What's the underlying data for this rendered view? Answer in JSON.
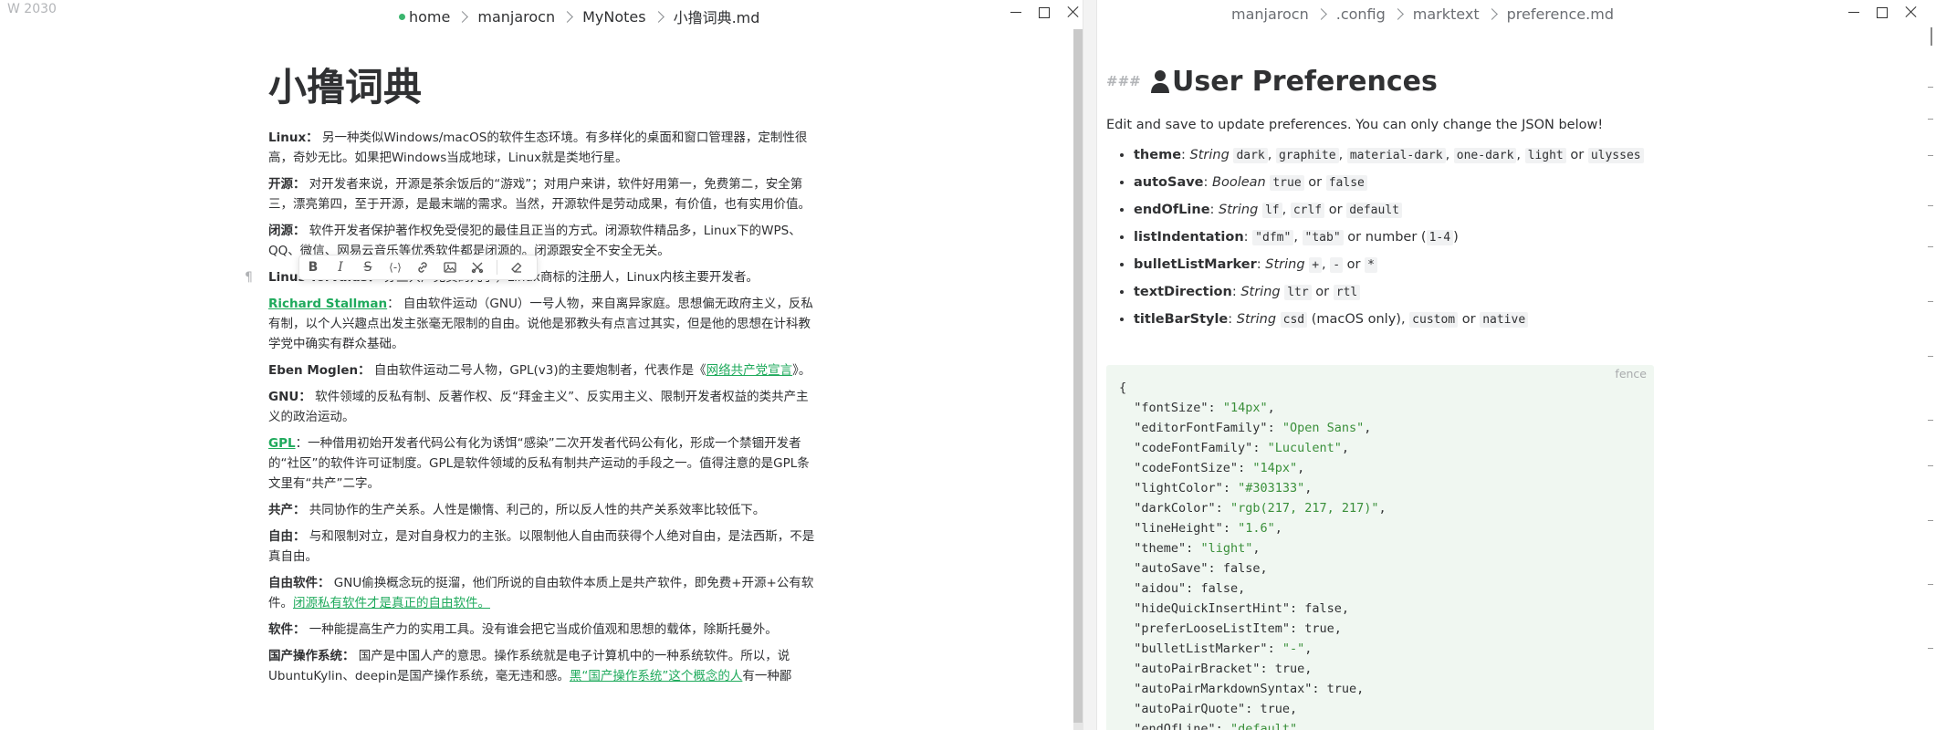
{
  "left": {
    "word_count": "W 2030",
    "breadcrumbs": [
      "home",
      "manjarocn",
      "MyNotes",
      "小撸词典.md"
    ],
    "title": "小撸词典",
    "terms": [
      {
        "name": "Linux：",
        "text": " 另一种类似Windows/macOS的软件生态环境。有多样化的桌面和窗口管理器，定制性很高，奇妙无比。如果把Windows当成地球，Linux就是类地行星。"
      },
      {
        "name": "开源：",
        "text": " 对开发者来说，开源是茶余饭后的“游戏”；对用户来讲，软件好用第一，免费第二，安全第三，漂亮第四，至于开源，是最末端的需求。当然，开源软件是劳动成果，有价值，也有实用价值。"
      },
      {
        "name": "闭源：",
        "text": " 软件开发者保护著作权免受侵犯的最佳且正当的方式。闭源软件精品多，Linux下的WPS、QQ、微信、网易云音乐等优秀软件都是闭源的。闭源跟安全不安全无关。"
      },
      {
        "name": "Linus Torvalds：",
        "text": " 芬兰共产党员的儿子，Linux商标的注册人，Linux内核主要开发者。"
      },
      {
        "name": "Richard Stallman",
        "name_link": true,
        "text": "： 自由软件运动（GNU）一号人物，来自离异家庭。思想偏无政府主义，反私有制，以个人兴趣点出发主张毫无限制的自由。说他是邪教头有点言过其实，但是他的思想在计科教学党中确实有群众基础。"
      },
      {
        "name": "Eben Moglen：",
        "text": " 自由软件运动二号人物，GPL(v3)的主要炮制者，代表作是《",
        "link": "网络共产党宣言",
        "after": "》。"
      },
      {
        "name": "GNU：",
        "text": " 软件领域的反私有制、反著作权、反“拜金主义”、反实用主义、限制开发者权益的类共产主义的政治运动。"
      },
      {
        "name": "GPL",
        "name_link": true,
        "text": "：一种借用初始开发者代码公有化为诱饵“感染”二次开发者代码公有化，形成一个禁锢开发者的“社区”的软件许可证制度。GPL是软件领域的反私有制共产运动的手段之一。值得注意的是GPL条文里有“共产”二字。"
      },
      {
        "name": "共产：",
        "text": " 共同协作的生产关系。人性是懒惰、利己的，所以反人性的共产关系效率比较低下。"
      },
      {
        "name": "自由：",
        "text": " 与和限制对立，是对自身权力的主张。以限制他人自由而获得个人绝对自由，是法西斯，不是真自由。"
      },
      {
        "name": "自由软件：",
        "text": " GNU偷换概念玩的挺溜，他们所说的自由软件本质上是共产软件，即免费+开源+公有软件。",
        "link": "闭源私有软件才是真正的自由软件。",
        "after": ""
      },
      {
        "name": "软件：",
        "text": " 一种能提高生产力的实用工具。没有谁会把它当成价值观和思想的载体，除斯托曼外。"
      },
      {
        "name": "国产操作系统：",
        "text": " 国产是中国人产的意思。操作系统就是电子计算机中的一种系统软件。所以，说UbuntuKylin、deepin是国产操作系统，毫无违和感。",
        "link": "黑“国产操作系统”这个概念的人",
        "after": "有一种鄙"
      }
    ],
    "toolbar": {
      "bold": "B",
      "italic": "I",
      "strike": "S",
      "code": "⟨-⟩"
    },
    "pilcrow": "¶"
  },
  "right": {
    "breadcrumbs": [
      "manjarocn",
      ".config",
      "marktext",
      "preference.md"
    ],
    "heading_marker": "###",
    "title": "User Preferences",
    "intro": "Edit and save to update preferences. You can only change the JSON below!",
    "prefs": [
      {
        "key": "theme",
        "type": "String",
        "segments": [
          {
            "c": "dark"
          },
          {
            "t": ", "
          },
          {
            "c": "graphite"
          },
          {
            "t": ", "
          },
          {
            "c": "material-dark"
          },
          {
            "t": ", "
          },
          {
            "c": "one-dark"
          },
          {
            "t": ", "
          },
          {
            "c": "light"
          },
          {
            "t": " or "
          },
          {
            "c": "ulysses"
          }
        ]
      },
      {
        "key": "autoSave",
        "type": "Boolean",
        "segments": [
          {
            "c": "true"
          },
          {
            "t": " or "
          },
          {
            "c": "false"
          }
        ]
      },
      {
        "key": "endOfLine",
        "type": "String",
        "segments": [
          {
            "c": "lf"
          },
          {
            "t": ", "
          },
          {
            "c": "crlf"
          },
          {
            "t": " or "
          },
          {
            "c": "default"
          }
        ]
      },
      {
        "key": "listIndentation",
        "type": "",
        "segments": [
          {
            "c": "\"dfm\""
          },
          {
            "t": ", "
          },
          {
            "c": "\"tab\""
          },
          {
            "t": " or number ("
          },
          {
            "c": "1-4"
          },
          {
            "t": ")"
          }
        ]
      },
      {
        "key": "bulletListMarker",
        "type": "String",
        "segments": [
          {
            "c": "+"
          },
          {
            "t": ", "
          },
          {
            "c": "-"
          },
          {
            "t": " or "
          },
          {
            "c": "*"
          }
        ]
      },
      {
        "key": "textDirection",
        "type": "String",
        "segments": [
          {
            "c": "ltr"
          },
          {
            "t": " or "
          },
          {
            "c": "rtl"
          }
        ]
      },
      {
        "key": "titleBarStyle",
        "type": "String",
        "segments": [
          {
            "c": "csd"
          },
          {
            "t": " (macOS only), "
          },
          {
            "c": "custom"
          },
          {
            "t": " or "
          },
          {
            "c": "native"
          }
        ]
      }
    ],
    "fence_label": "fence",
    "code_lines": [
      {
        "raw": "{"
      },
      {
        "k": "\"fontSize\"",
        "v": "\"14px\"",
        "str": true
      },
      {
        "k": "\"editorFontFamily\"",
        "v": "\"Open Sans\"",
        "str": true
      },
      {
        "k": "\"codeFontFamily\"",
        "v": "\"Luculent\"",
        "str": true
      },
      {
        "k": "\"codeFontSize\"",
        "v": "\"14px\"",
        "str": true
      },
      {
        "k": "\"lightColor\"",
        "v": "\"#303133\"",
        "str": true
      },
      {
        "k": "\"darkColor\"",
        "v": "\"rgb(217, 217, 217)\"",
        "str": true
      },
      {
        "k": "\"lineHeight\"",
        "v": "\"1.6\"",
        "str": true
      },
      {
        "k": "\"theme\"",
        "v": "\"light\"",
        "str": true
      },
      {
        "k": "\"autoSave\"",
        "v": "false",
        "str": false
      },
      {
        "k": "\"aidou\"",
        "v": "false",
        "str": false
      },
      {
        "k": "\"hideQuickInsertHint\"",
        "v": "false",
        "str": false
      },
      {
        "k": "\"preferLooseListItem\"",
        "v": "true",
        "str": false
      },
      {
        "k": "\"bulletListMarker\"",
        "v": "\"-\"",
        "str": true
      },
      {
        "k": "\"autoPairBracket\"",
        "v": "true",
        "str": false
      },
      {
        "k": "\"autoPairMarkdownSyntax\"",
        "v": "true",
        "str": false
      },
      {
        "k": "\"autoPairQuote\"",
        "v": "true",
        "str": false
      },
      {
        "k": "\"endOfLine\"",
        "v": "\"default\"",
        "str": true
      }
    ]
  },
  "colors": {
    "accent": "#1faa5c",
    "fence_bg": "#f0f7f1",
    "text": "#303133"
  }
}
